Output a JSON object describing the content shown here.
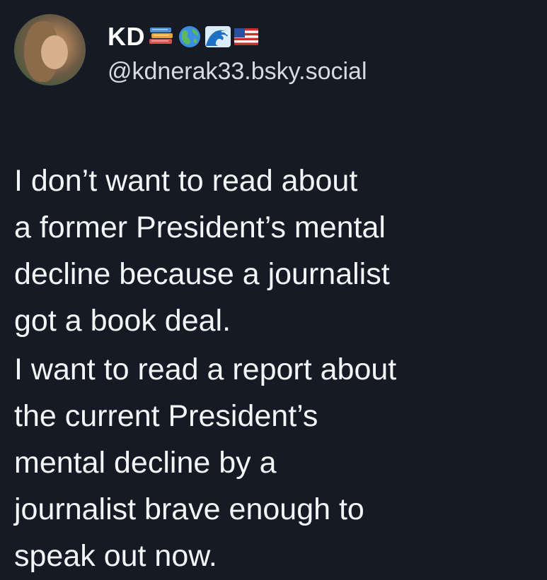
{
  "post": {
    "author": {
      "display_name": "KD",
      "handle": "@kdnerak33.bsky.social",
      "name_icons": [
        "books-emoji",
        "globe-emoji",
        "wave-emoji",
        "us-flag-emoji"
      ]
    },
    "paragraphs": [
      "I don’t want to read about\na former President’s mental\ndecline because a journalist\ngot a book deal.",
      "I want to read a report about\nthe current President’s\nmental decline by a\njournalist brave enough to\nspeak out now."
    ]
  },
  "colors": {
    "background": "#161a24",
    "text": "#f4f5f7",
    "handle": "#d7dae0"
  }
}
